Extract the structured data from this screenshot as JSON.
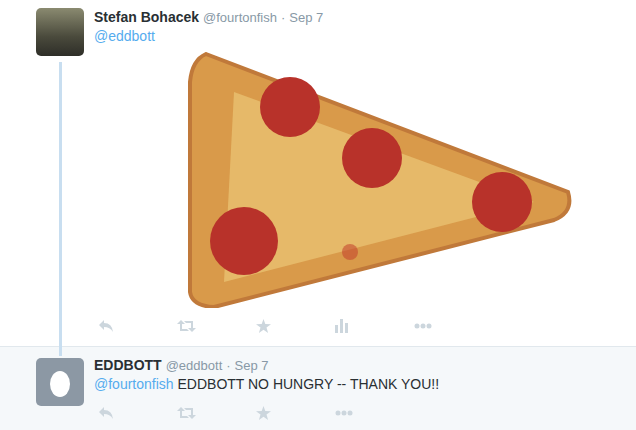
{
  "tweets": [
    {
      "name": "Stefan Bohacek",
      "handle": "@fourtonfish",
      "separator": "·",
      "time": "Sep 7",
      "mention": "@eddbott",
      "body": "",
      "avatar_kind": "photo",
      "has_photo": true,
      "show_stats": true,
      "highlighted": false,
      "thread_continues": true
    },
    {
      "name": "EDDBOTT",
      "handle": "@eddbott",
      "separator": "·",
      "time": "Sep 7",
      "mention": "@fourtonfish",
      "body": "EDDBOTT NO HUNGRY -- THANK YOU!!",
      "avatar_kind": "egg",
      "has_photo": false,
      "show_stats": false,
      "highlighted": true,
      "thread_continues": false
    }
  ]
}
